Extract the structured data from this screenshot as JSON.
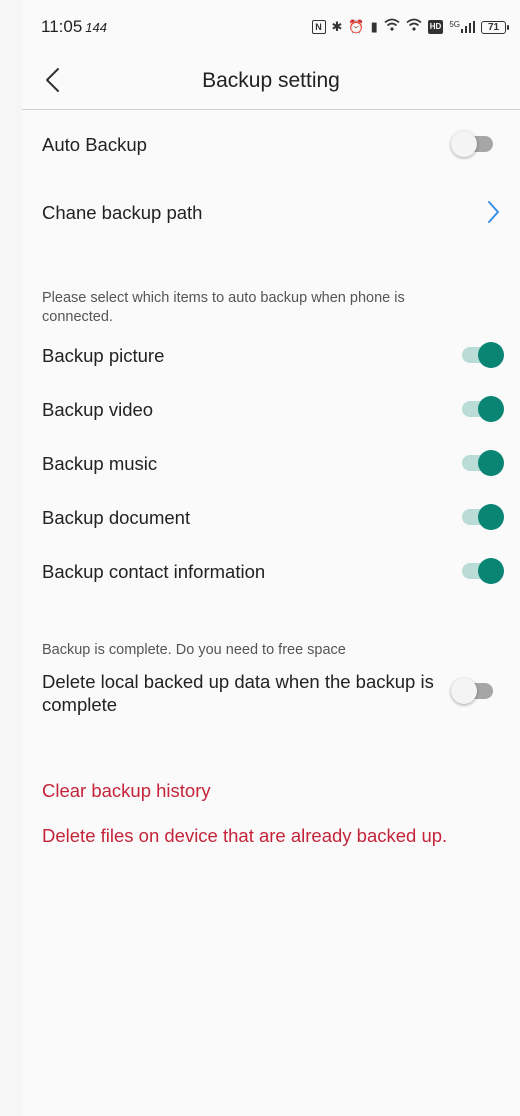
{
  "status_bar": {
    "time": "11:05",
    "refresh_rate": "144",
    "network": "5G",
    "battery": "71",
    "icons": [
      "nfc-icon",
      "bluetooth-icon",
      "alarm-icon",
      "vibrate-icon",
      "wifi-icon",
      "wifi-icon",
      "hd-icon",
      "signal-icon",
      "battery-icon"
    ]
  },
  "header": {
    "title": "Backup setting"
  },
  "settings": {
    "auto_backup": {
      "label": "Auto Backup",
      "enabled": false
    },
    "backup_path": {
      "label": "Chane backup path"
    }
  },
  "items_hint": "Please select which items to auto backup when phone is connected.",
  "items": [
    {
      "label": "Backup picture",
      "enabled": true
    },
    {
      "label": "Backup video",
      "enabled": true
    },
    {
      "label": "Backup music",
      "enabled": true
    },
    {
      "label": "Backup document",
      "enabled": true
    },
    {
      "label": "Backup contact information",
      "enabled": true
    }
  ],
  "free_space": {
    "hint": "Backup is complete. Do you need to free space",
    "label": "Delete local backed up data when the backup is complete",
    "enabled": false
  },
  "actions": {
    "clear_history": "Clear backup history",
    "delete_files": "Delete files on device that are already backed up."
  },
  "colors": {
    "accent": "#0b8573",
    "accent_track": "#b9dcd6",
    "danger": "#c4243a",
    "link": "#3a8ee6"
  }
}
